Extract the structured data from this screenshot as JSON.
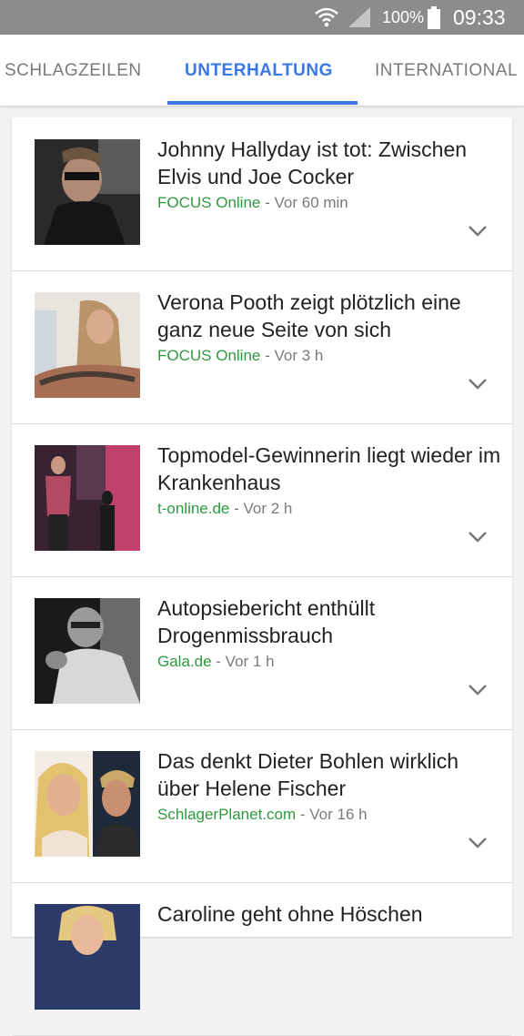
{
  "status_bar": {
    "battery_percent": "100%",
    "time": "09:33",
    "icons": [
      "wifi-icon",
      "signal-icon",
      "battery-icon"
    ]
  },
  "tabs": [
    {
      "label": "SCHLAGZEILEN",
      "active": false
    },
    {
      "label": "UNTERHALTUNG",
      "active": true
    },
    {
      "label": "INTERNATIONAL",
      "active": false
    }
  ],
  "colors": {
    "accent": "#3b78e7",
    "source": "#2e9a3f",
    "status_bar": "#8c8c8c"
  },
  "articles": [
    {
      "headline": "Johnny Hallyday ist tot: Zwischen Elvis und Joe Cocker",
      "source": "FOCUS Online",
      "time": "- Vor 60 min"
    },
    {
      "headline": "Verona Pooth zeigt plötzlich eine ganz neue Seite von sich",
      "source": "FOCUS Online",
      "time": "- Vor 3 h"
    },
    {
      "headline": "Topmodel-Gewinnerin liegt wieder im Krankenhaus",
      "source": "t-online.de",
      "time": "- Vor 2 h"
    },
    {
      "headline": "Autopsiebericht enthüllt Drogenmissbrauch",
      "source": "Gala.de",
      "time": "- Vor 1 h"
    },
    {
      "headline": "Das denkt Dieter Bohlen wirklich über Helene Fischer",
      "source": "SchlagerPlanet.com",
      "time": "- Vor 16 h"
    },
    {
      "headline": "Caroline geht ohne Höschen",
      "source": "",
      "time": ""
    }
  ]
}
